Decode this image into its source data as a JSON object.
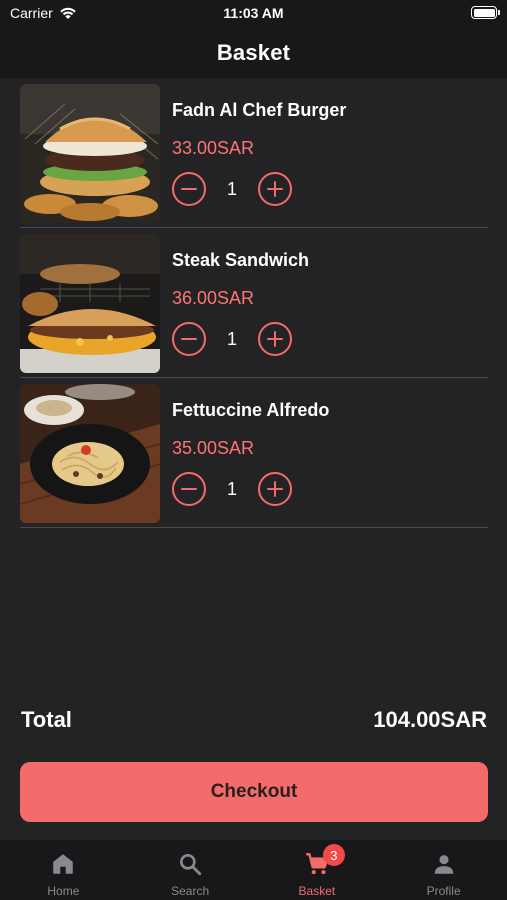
{
  "status_bar": {
    "carrier": "Carrier",
    "time": "11:03 AM"
  },
  "header": {
    "title": "Basket"
  },
  "items": [
    {
      "name": "Fadn Al Chef Burger",
      "price": "33.00SAR",
      "quantity": "1"
    },
    {
      "name": "Steak Sandwich",
      "price": "36.00SAR",
      "quantity": "1"
    },
    {
      "name": "Fettuccine Alfredo",
      "price": "35.00SAR",
      "quantity": "1"
    }
  ],
  "total": {
    "label": "Total",
    "value": "104.00SAR"
  },
  "checkout": {
    "label": "Checkout"
  },
  "tabs": [
    {
      "label": "Home",
      "icon": "home-icon"
    },
    {
      "label": "Search",
      "icon": "search-icon"
    },
    {
      "label": "Basket",
      "icon": "cart-icon",
      "badge": "3",
      "active": true
    },
    {
      "label": "Profile",
      "icon": "person-icon"
    }
  ],
  "colors": {
    "accent": "#f36b6b",
    "price": "#ff7373",
    "background": "#232326",
    "bar": "#18181a",
    "badge": "#f04a4a"
  }
}
